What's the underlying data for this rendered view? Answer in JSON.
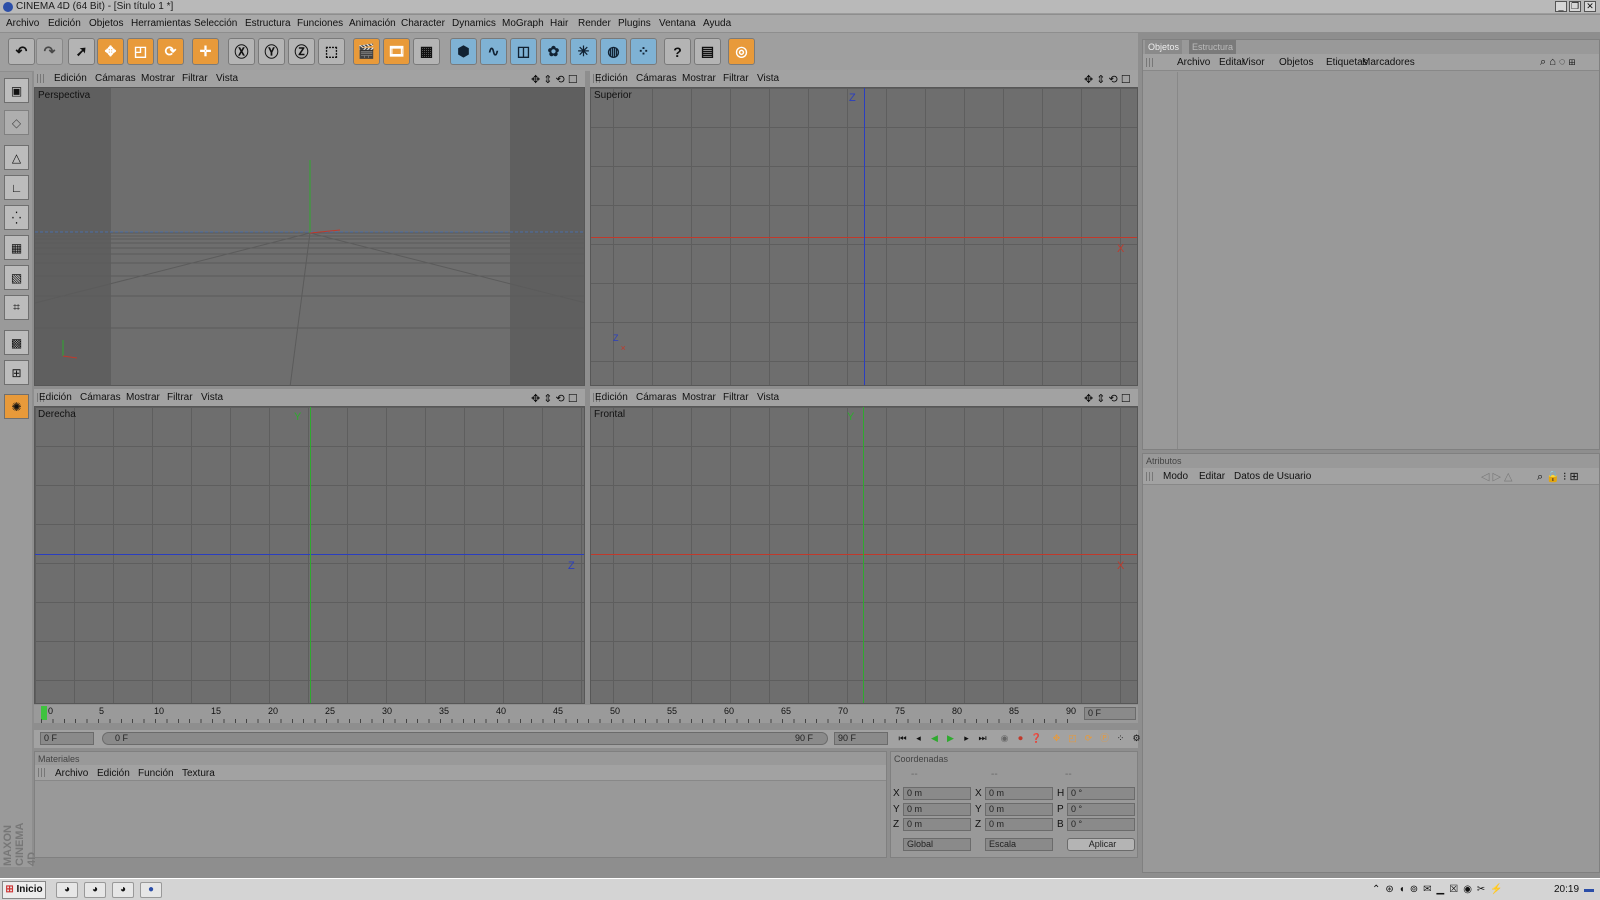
{
  "window": {
    "title": "CINEMA 4D (64 Bit) - [Sin título 1 *]"
  },
  "menu": [
    "Archivo",
    "Edición",
    "Objetos",
    "Herramientas",
    "Selección",
    "Estructura",
    "Funciones",
    "Animación",
    "Character",
    "Dynamics",
    "MoGraph",
    "Hair",
    "Render",
    "Plugins",
    "Ventana",
    "Ayuda"
  ],
  "viewport_menu": [
    "Edición",
    "Cámaras",
    "Mostrar",
    "Filtrar",
    "Vista"
  ],
  "viewports": {
    "perspective": {
      "label": "Perspectiva"
    },
    "top": {
      "label": "Superior",
      "axis_h": "X",
      "axis_v": "Z"
    },
    "right": {
      "label": "Derecha",
      "axis_h": "Z",
      "axis_v": "Y"
    },
    "front": {
      "label": "Frontal",
      "axis_h": "X",
      "axis_v": "Y"
    }
  },
  "timeline": {
    "ticks": [
      "0",
      "5",
      "10",
      "15",
      "20",
      "25",
      "30",
      "35",
      "40",
      "45",
      "50",
      "55",
      "60",
      "65",
      "70",
      "75",
      "80",
      "85",
      "90"
    ],
    "current": "0 F",
    "start": "0 F",
    "range_start": "0 F",
    "range_end": "90 F",
    "end": "90 F"
  },
  "objects_panel": {
    "tabs": [
      "Objetos",
      "Estructura"
    ],
    "menu": [
      "Archivo",
      "Editar",
      "Visor",
      "Objetos",
      "Etiquetas",
      "Marcadores"
    ]
  },
  "attributes_panel": {
    "title": "Atributos",
    "menu": [
      "Modo",
      "Editar",
      "Datos de Usuario"
    ]
  },
  "materials_panel": {
    "title": "Materiales",
    "menu": [
      "Archivo",
      "Edición",
      "Función",
      "Textura"
    ]
  },
  "coordinates_panel": {
    "title": "Coordenadas",
    "dashes": [
      "--",
      "--",
      "--"
    ],
    "rows": [
      {
        "a": "X",
        "av": "0 m",
        "b": "X",
        "bv": "0 m",
        "c": "H",
        "cv": "0 °"
      },
      {
        "a": "Y",
        "av": "0 m",
        "b": "Y",
        "bv": "0 m",
        "c": "P",
        "cv": "0 °"
      },
      {
        "a": "Z",
        "av": "0 m",
        "b": "Z",
        "bv": "0 m",
        "c": "B",
        "cv": "0 °"
      }
    ],
    "mode1": "Global",
    "mode2": "Escala",
    "apply": "Aplicar"
  },
  "brand": "MAXON CINEMA 4D",
  "taskbar": {
    "start": "Inicio",
    "clock": "20:19"
  },
  "colors": {
    "accent_x": "#c0392b",
    "accent_y": "#2eaa2e",
    "accent_z": "#2a3ec0",
    "orange_tool": "#e89a3a"
  }
}
